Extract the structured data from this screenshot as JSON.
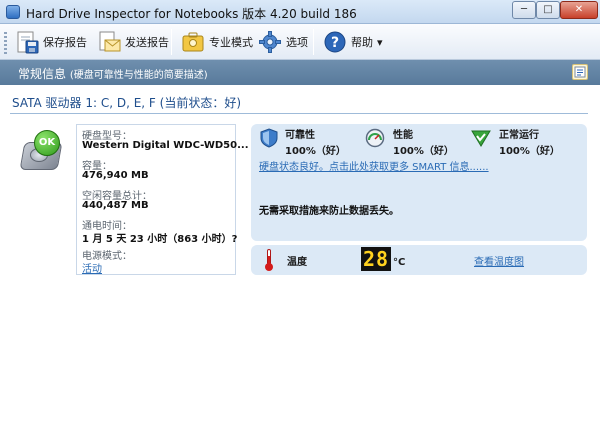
{
  "window": {
    "title": "Hard Drive Inspector for Notebooks 版本 4.20 build 186",
    "minimize_glyph": "─",
    "maximize_glyph": "□",
    "close_glyph": "✕"
  },
  "toolbar": {
    "save_report": "保存报告",
    "send_report": "发送报告",
    "expert_mode": "专业模式",
    "options": "选项",
    "help": "帮助",
    "help_arrow": "▾"
  },
  "section": {
    "title": "常规信息",
    "subtitle": "(硬盘可靠性与性能的简要描述)"
  },
  "drive": {
    "header": "SATA 驱动器 1: C, D, E, F (当前状态：好)",
    "status_badge": "OK"
  },
  "info": {
    "model_label": "硬盘型号：",
    "model_value": "Western Digital WDC-WD50...",
    "capacity_label": "容量：",
    "capacity_value": "476,940 MB",
    "free_label": "空闲容量总计：",
    "free_value": "440,487 MB",
    "power_on_label": "通电时间：",
    "power_on_value": "1 月 5 天 23 小时（863 小时）?",
    "power_mode_label": "电源模式：",
    "power_mode_value": "活动"
  },
  "status": {
    "reliability_label": "可靠性",
    "reliability_value": "100%（好）",
    "performance_label": "性能",
    "performance_value": "100%（好）",
    "normal_label": "正常运行",
    "normal_value": "100%（好）",
    "smart_link": "硬盘状态良好。点击此处获取更多 SMART 信息......",
    "message": "无需采取措施来防止数据丢失。"
  },
  "temperature": {
    "label": "温度",
    "value": "28",
    "unit": "°C",
    "link": "查看温度图"
  },
  "colors": {
    "accent": "#587a9b",
    "ok_green": "#2f9a1a",
    "link": "#2a6bb5",
    "temp_digits": "#ffd21f"
  },
  "icons": [
    "app-icon",
    "save-report-icon",
    "send-report-icon",
    "expert-mode-icon",
    "options-gear-icon",
    "help-icon",
    "info-icon",
    "hard-drive-icon",
    "shield-icon",
    "gauge-icon",
    "checkmark-triangle-icon",
    "thermometer-icon"
  ]
}
